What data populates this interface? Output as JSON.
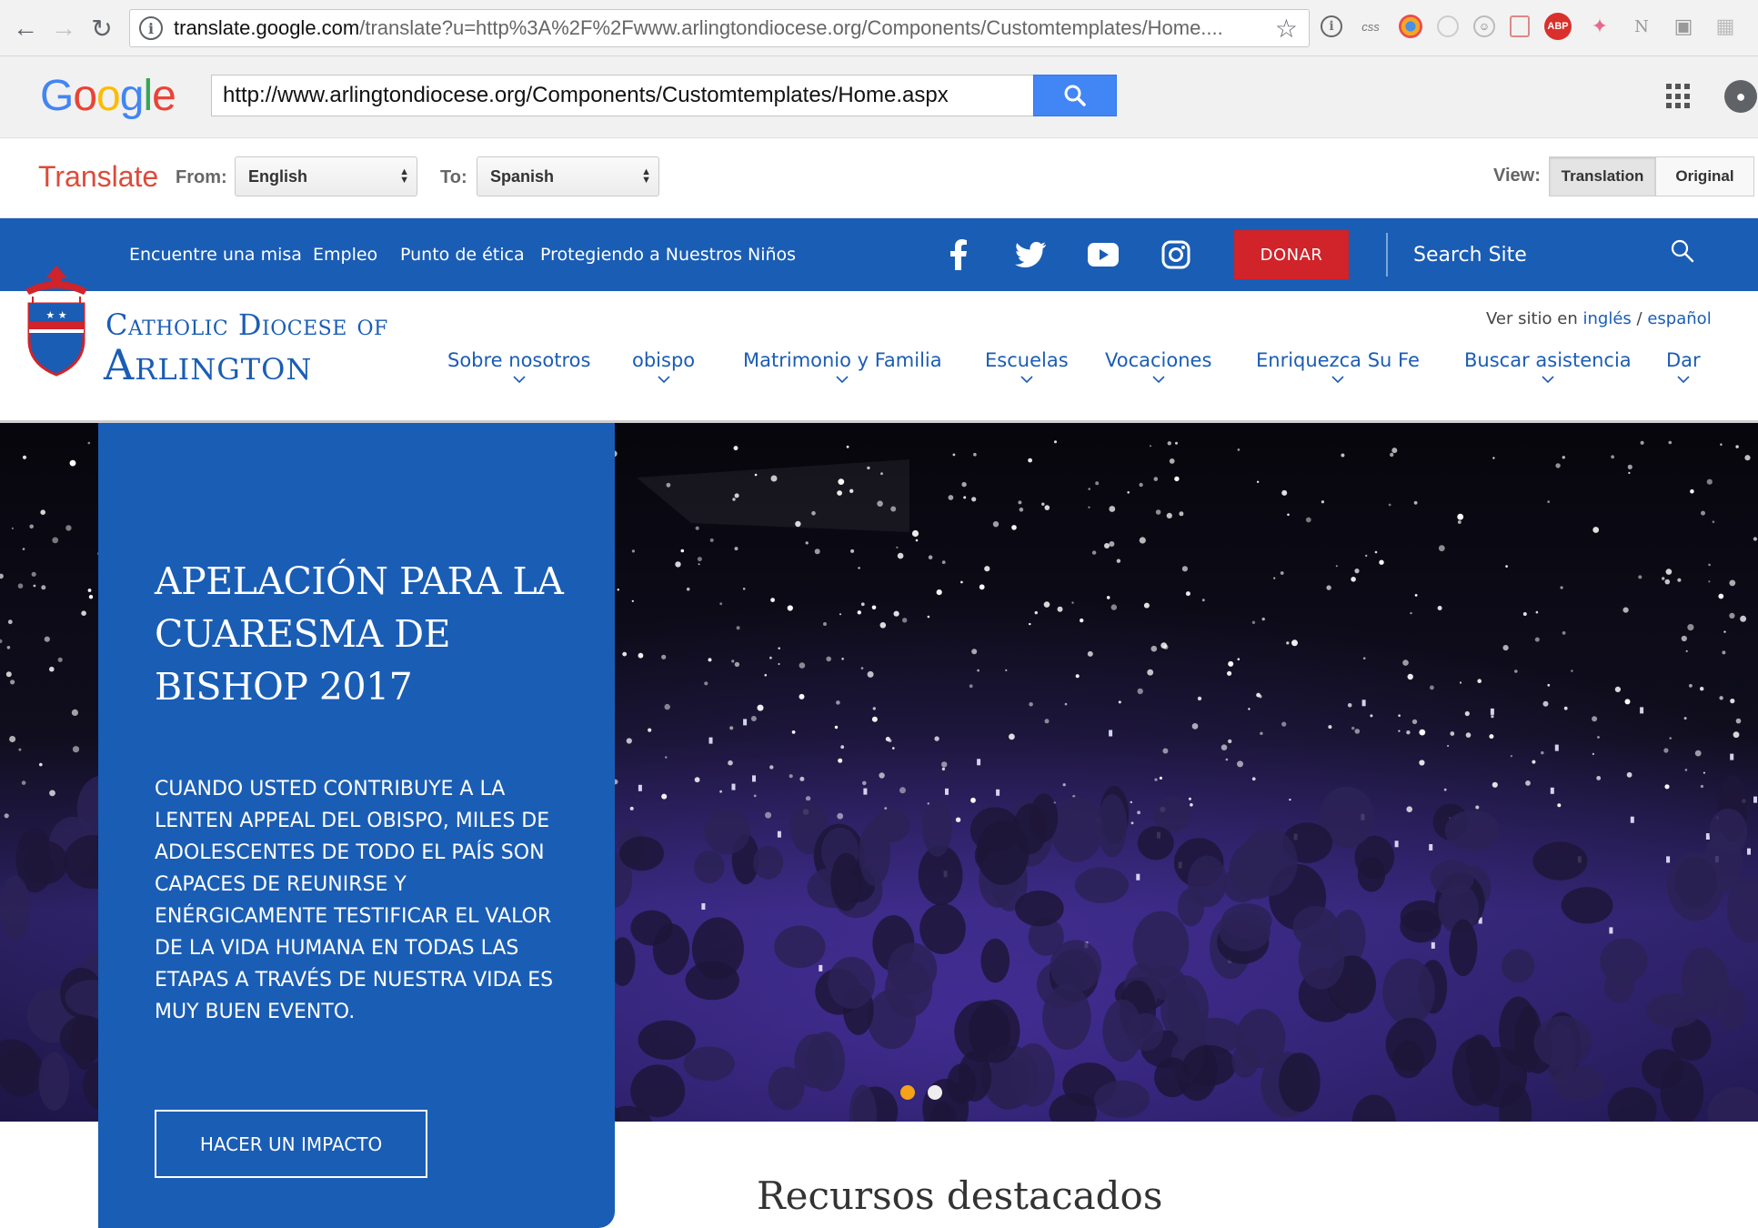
{
  "browser": {
    "url_host": "translate.google.com",
    "url_path": "/translate?u=http%3A%2F%2Fwww.arlingtondiocese.org/Components/Customtemplates/Home....",
    "extensions": [
      "info",
      "css",
      "color",
      "shape",
      "smile",
      "note",
      "ABP",
      "bird",
      "N",
      "camera",
      "grid"
    ]
  },
  "google": {
    "logo_letters": [
      "G",
      "o",
      "o",
      "g",
      "l",
      "e"
    ],
    "url_value": "http://www.arlingtondiocese.org/Components/Customtemplates/Home.aspx",
    "accent": "#4285f4"
  },
  "translate": {
    "title": "Translate",
    "from_label": "From:",
    "from_value": "English",
    "to_label": "To:",
    "to_value": "Spanish",
    "view_label": "View:",
    "view_translation": "Translation",
    "view_original": "Original"
  },
  "site": {
    "brand_color": "#1a5db5",
    "top_links": [
      "Encuentre una misa",
      "Empleo",
      "Punto de ética",
      "Protegiendo a Nuestros Niños"
    ],
    "donate_label": "DONAR",
    "donate_color": "#d0232a",
    "search_placeholder": "Search Site",
    "logo_line1": "Catholic Diocese of",
    "logo_line2": "Arlington",
    "lang_prefix": "Ver sitio en",
    "lang_english": "inglés",
    "lang_sep": "/",
    "lang_spanish": "español",
    "nav": [
      "Sobre nosotros",
      "obispo",
      "Matrimonio y Familia",
      "Escuelas",
      "Vocaciones",
      "Enriquezca Su Fe",
      "Buscar asistencia",
      "Dar"
    ]
  },
  "hero": {
    "title": "APELACIÓN PARA LA CUARESMA DE BISHOP 2017",
    "body": "CUANDO USTED CONTRIBUYE A LA LENTEN APPEAL DEL OBISPO, MILES DE ADOLESCENTES DE TODO EL PAÍS SON CAPACES DE REUNIRSE Y ENÉRGICAMENTE TESTIFICAR EL VALOR DE LA VIDA HUMANA EN TODAS LAS ETAPAS A TRAVÉS DE NUESTRA VIDA ES MUY BUEN EVENTO.",
    "cta": "HACER UN IMPACTO",
    "slide_count": 2,
    "active_slide": 1
  },
  "featured": {
    "title": "Recursos destacados"
  }
}
